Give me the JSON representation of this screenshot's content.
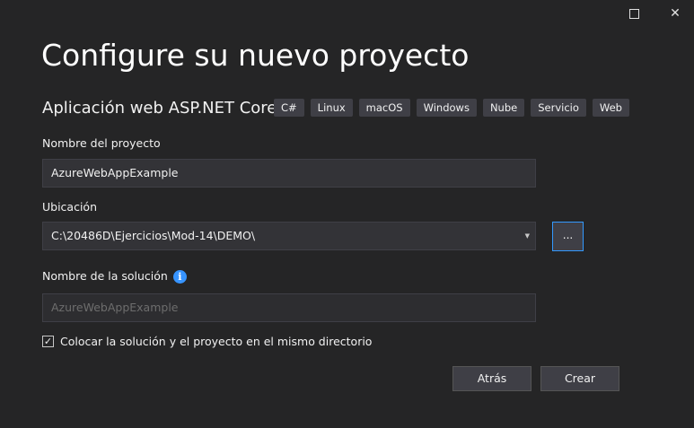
{
  "window": {
    "maximize_icon": "maximize-icon",
    "close_icon": "close-icon"
  },
  "header": {
    "title": "Configure su nuevo proyecto",
    "template_name": "Aplicación web ASP.NET Core",
    "tags": [
      "C#",
      "Linux",
      "macOS",
      "Windows",
      "Nube",
      "Servicio",
      "Web"
    ]
  },
  "form": {
    "project_name_label": "Nombre del proyecto",
    "project_name_value": "AzureWebAppExample",
    "location_label": "Ubicación",
    "location_value": "C:\\20486D\\Ejercicios\\Mod-14\\DEMO\\",
    "browse_label": "...",
    "solution_name_label": "Nombre de la solución",
    "solution_name_value": "AzureWebAppExample",
    "same_dir_label": "Colocar la solución y el proyecto en el mismo directorio",
    "same_dir_checked": true
  },
  "footer": {
    "back_label": "Atrás",
    "create_label": "Crear"
  }
}
